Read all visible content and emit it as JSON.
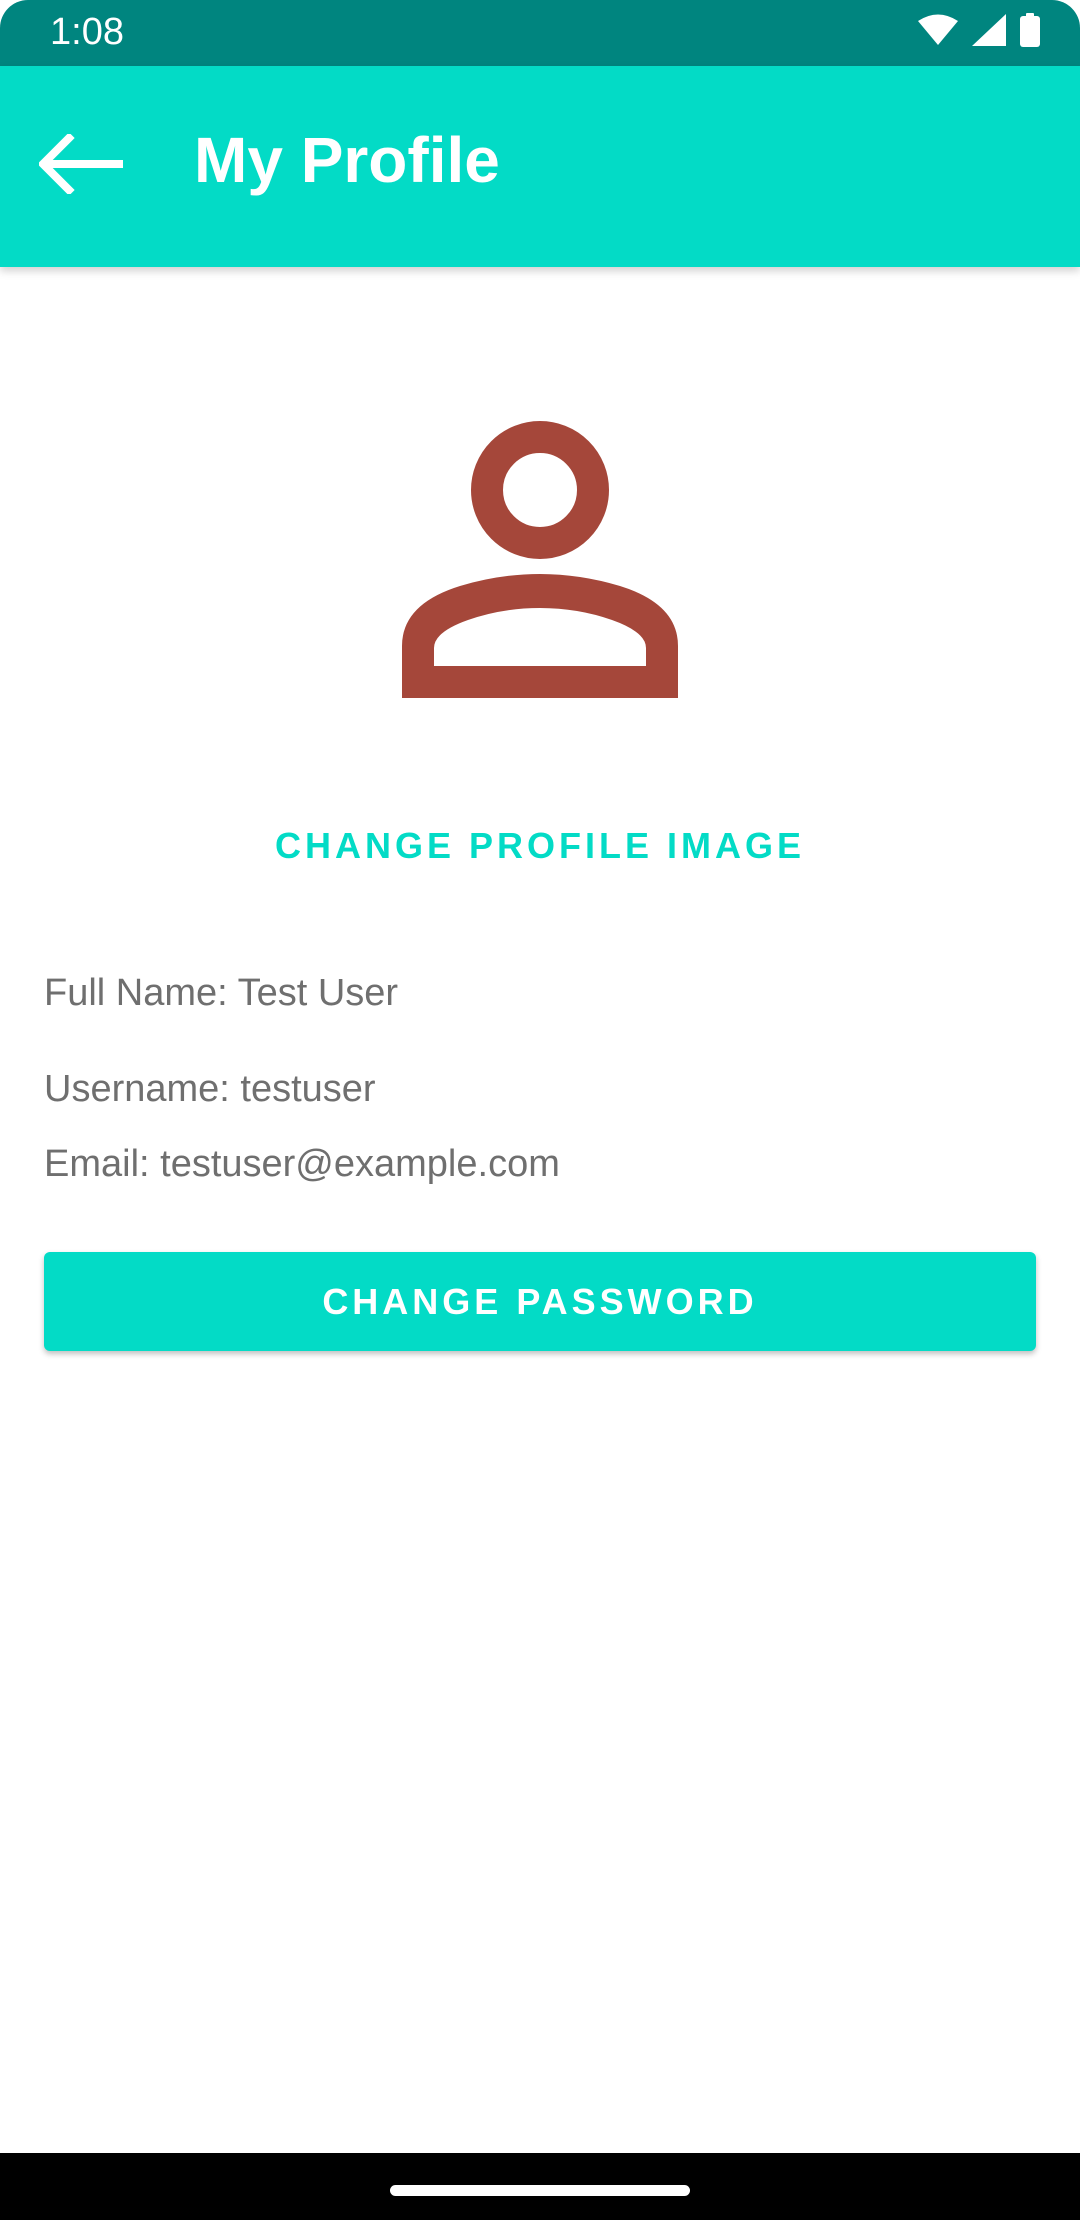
{
  "status_bar": {
    "time": "1:08",
    "icons": [
      "wifi-icon",
      "signal-icon",
      "battery-icon"
    ],
    "background": "#00857f"
  },
  "app_bar": {
    "title": "My Profile",
    "back_icon": "back-arrow-icon",
    "background": "#03dbc6"
  },
  "profile": {
    "avatar_icon": "person-icon",
    "avatar_color": "#a5473a",
    "change_image_label": "CHANGE PROFILE IMAGE",
    "full_name": "Full Name: Test User",
    "username": "Username: testuser",
    "email": "Email: testuser@example.com",
    "change_password_label": "CHANGE PASSWORD"
  },
  "theme": {
    "accent": "#03dbc6",
    "text_secondary": "#6f6f6f"
  }
}
